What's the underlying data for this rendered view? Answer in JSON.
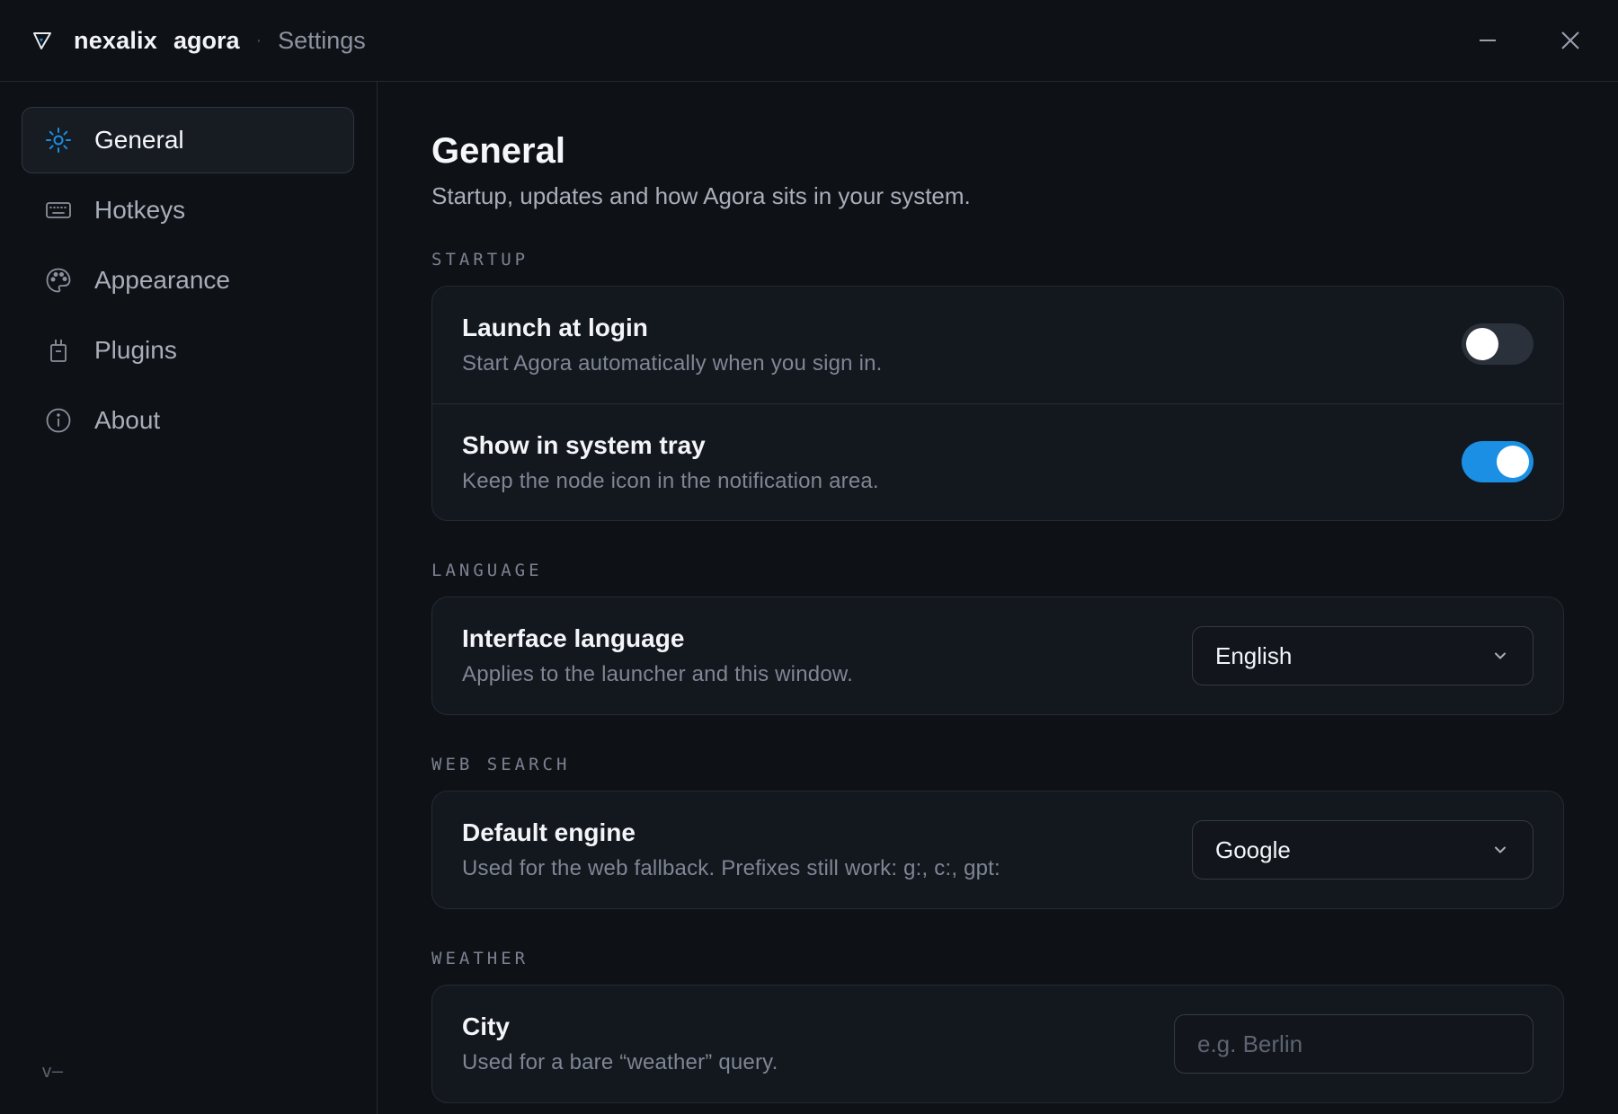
{
  "titlebar": {
    "brand_part1": "nexalix",
    "brand_part2": "agora",
    "separator": "·",
    "section": "Settings"
  },
  "colors": {
    "accent": "#1a8fe3",
    "background": "#0e1116",
    "card": "#13171e"
  },
  "sidebar": {
    "items": [
      {
        "label": "General",
        "icon": "sun-gear-icon",
        "active": true
      },
      {
        "label": "Hotkeys",
        "icon": "keyboard-icon",
        "active": false
      },
      {
        "label": "Appearance",
        "icon": "palette-icon",
        "active": false
      },
      {
        "label": "Plugins",
        "icon": "plug-icon",
        "active": false
      },
      {
        "label": "About",
        "icon": "info-icon",
        "active": false
      }
    ],
    "version": "v—"
  },
  "main": {
    "title": "General",
    "subtitle": "Startup, updates and how Agora sits in your system.",
    "sections": {
      "startup": {
        "label": "STARTUP",
        "rows": [
          {
            "title": "Launch at login",
            "desc": "Start Agora automatically when you sign in.",
            "enabled": false
          },
          {
            "title": "Show in system tray",
            "desc": "Keep the node icon in the notification area.",
            "enabled": true
          }
        ]
      },
      "language": {
        "label": "LANGUAGE",
        "row": {
          "title": "Interface language",
          "desc": "Applies to the launcher and this window.",
          "value": "English"
        }
      },
      "web_search": {
        "label": "WEB SEARCH",
        "row": {
          "title": "Default engine",
          "desc": "Used for the web fallback. Prefixes still work: g:, c:, gpt:",
          "value": "Google"
        }
      },
      "weather": {
        "label": "WEATHER",
        "row": {
          "title": "City",
          "desc": "Used for a bare “weather” query.",
          "value": "",
          "placeholder": "e.g. Berlin"
        }
      }
    }
  }
}
